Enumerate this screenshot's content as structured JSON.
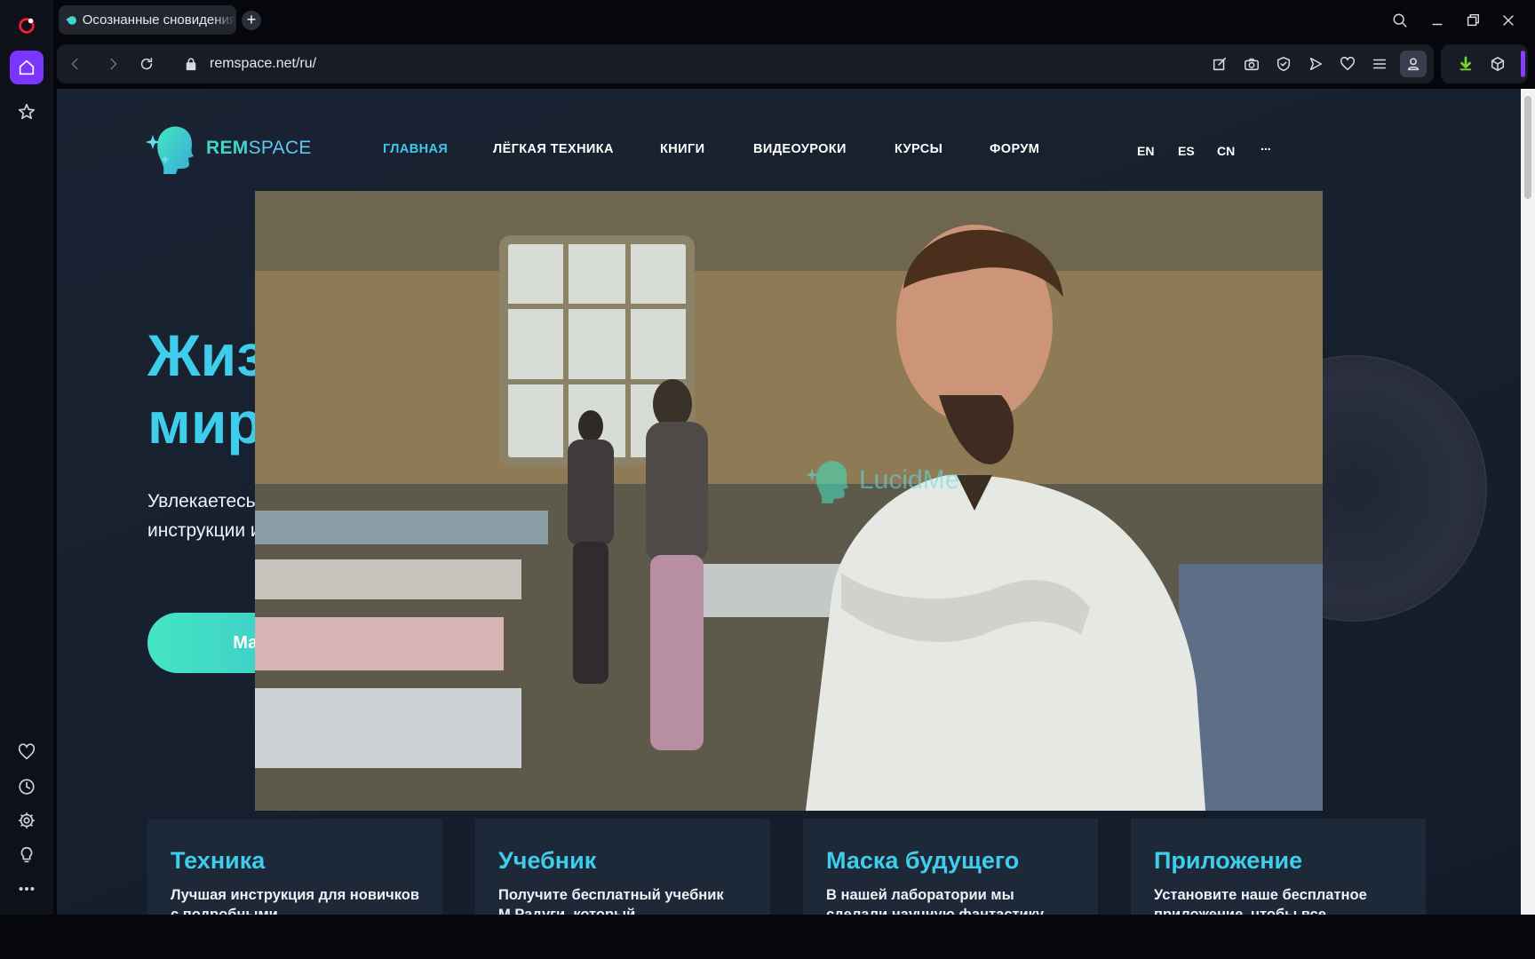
{
  "browser": {
    "tab_title": "Осознанные сновидения",
    "url": "remspace.net/ru/",
    "accent_color": "#8b3dff"
  },
  "sidebar": {
    "icons": [
      "opera-logo-icon",
      "home-icon",
      "star-icon",
      "heart-icon",
      "history-icon",
      "settings-icon",
      "lightbulb-icon",
      "more-icon"
    ]
  },
  "site": {
    "logo_bold": "REM",
    "logo_light": "SPACE",
    "nav": [
      "ГЛАВНАЯ",
      "ЛЁГКАЯ ТЕХНИКА",
      "КНИГИ",
      "ВИДЕОУРОКИ",
      "КУРСЫ",
      "ФОРУМ"
    ],
    "langs": [
      "EN",
      "ES",
      "CN",
      "..."
    ],
    "hero_title_line1": "Жизнь в двух",
    "hero_title_line2": "мирах",
    "hero_sub": "Увлекаетесь осознанными снами? Здесь вы найдете лучшие инструкции и технологии",
    "cta": "Маски для практики",
    "watermark": "LucidMe",
    "cards": [
      {
        "title": "Техника",
        "text": "Лучшая инструкция для новичков с подробными"
      },
      {
        "title": "Учебник",
        "text": "Получите бесплатный учебник М.Радуги, который"
      },
      {
        "title": "Маска будущего",
        "text": "В нашей лаборатории мы сделали научную фантастику"
      },
      {
        "title": "Приложение",
        "text": "Установите наше бесплатное приложение, чтобы все"
      }
    ]
  }
}
